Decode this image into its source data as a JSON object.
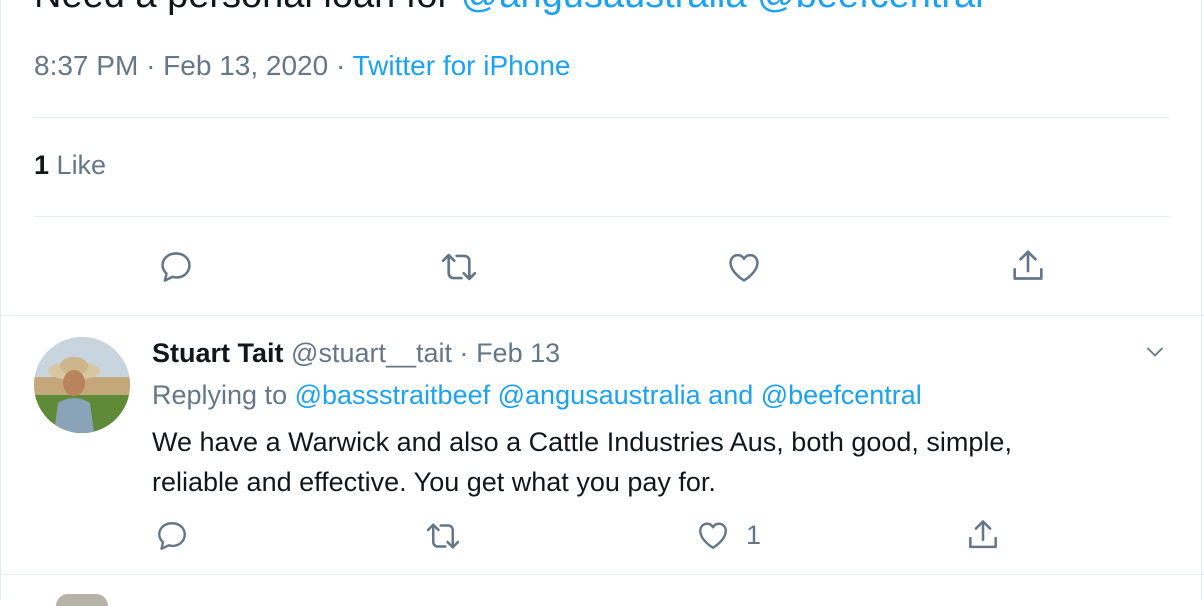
{
  "main_tweet": {
    "text_prefix": "Need a personal loan for ",
    "mention_1": "@angusaustralia",
    "mention_2": "@beefcentral",
    "time": "8:37 PM",
    "date": "Feb 13, 2020",
    "source": "Twitter for iPhone",
    "like_count": "1",
    "like_label": "Like"
  },
  "reply": {
    "name": "Stuart Tait",
    "handle": "@stuart__tait",
    "date": "Feb 13",
    "replying_to_label": "Replying to",
    "replying_to": [
      "@bassstraitbeef",
      "@angusaustralia",
      "and",
      "@beefcentral"
    ],
    "text_line_1": "We have a Warwick and also a Cattle Industries Aus, both good, simple,",
    "text_line_2": "reliable and effective. You get what you pay for.",
    "like_count": "1"
  },
  "colors": {
    "text": "#14171a",
    "secondary": "#657786",
    "accent": "#1da1f2",
    "divider": "#e6ecf0"
  },
  "icons": [
    "reply-icon",
    "retweet-icon",
    "like-icon",
    "share-icon",
    "chevron-down-icon"
  ]
}
